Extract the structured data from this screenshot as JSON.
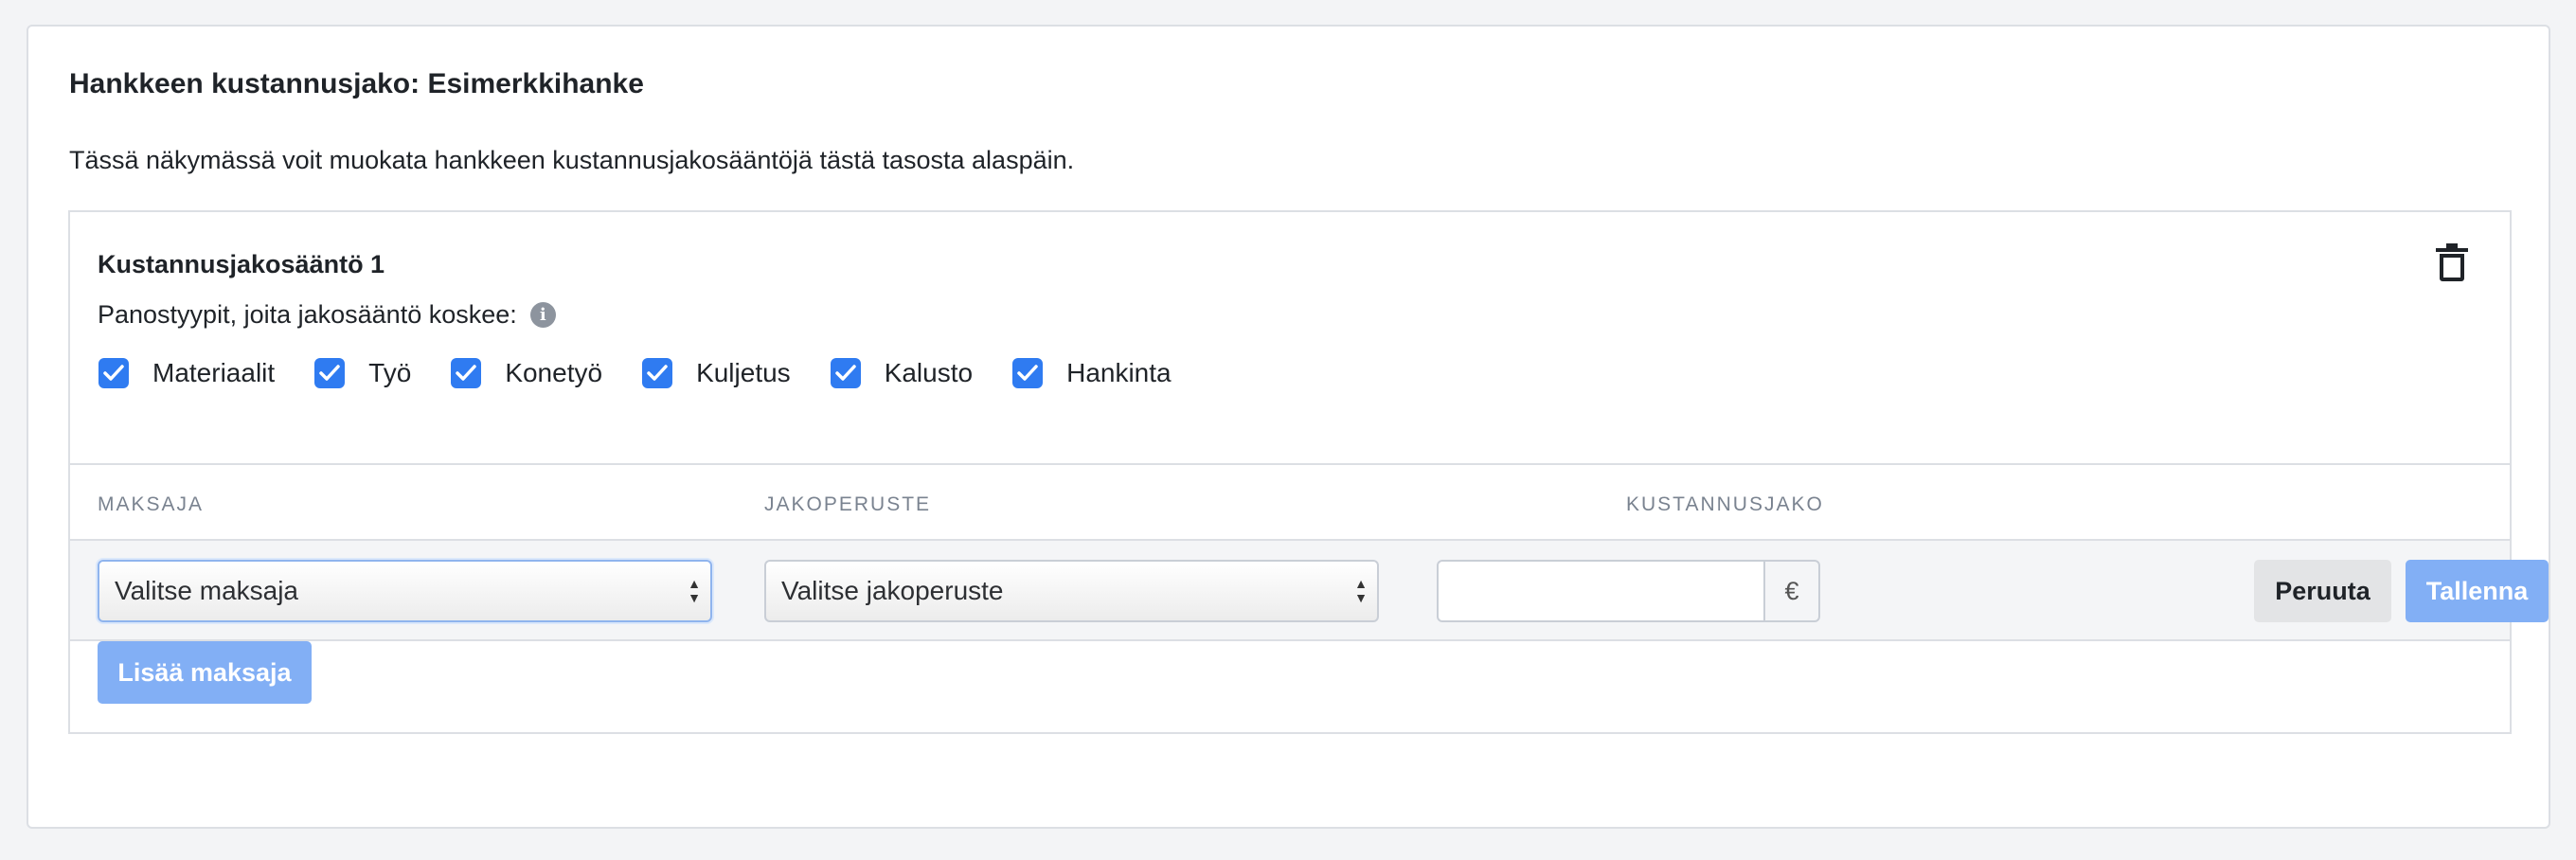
{
  "page": {
    "title": "Hankkeen kustannusjako: Esimerkkihanke",
    "description": "Tässä näkymässä voit muokata hankkeen kustannusjakosääntöjä tästä tasosta alaspäin."
  },
  "rule": {
    "title": "Kustannusjakosääntö 1",
    "types_label": "Panostyypit, joita jakosääntö koskee:",
    "info_glyph": "i",
    "types": [
      {
        "label": "Materiaalit",
        "checked": true
      },
      {
        "label": "Työ",
        "checked": true
      },
      {
        "label": "Konetyö",
        "checked": true
      },
      {
        "label": "Kuljetus",
        "checked": true
      },
      {
        "label": "Kalusto",
        "checked": true
      },
      {
        "label": "Hankinta",
        "checked": true
      }
    ]
  },
  "table": {
    "headers": {
      "payer": "MAKSAJA",
      "basis": "JAKOPERUSTE",
      "split": "KUSTANNUSJAKO"
    },
    "row": {
      "payer_select": "Valitse maksaja",
      "basis_select": "Valitse jakoperuste",
      "amount_value": "",
      "currency": "€",
      "cancel_label": "Peruuta",
      "save_label": "Tallenna"
    }
  },
  "actions": {
    "add_payer_label": "Lisää maksaja"
  },
  "icons": {
    "delete": "trash-icon",
    "info": "info-icon",
    "checkbox": "checkmark-icon"
  },
  "colors": {
    "accent": "#2f7bf1",
    "button_primary_disabled": "#82aff5",
    "button_secondary": "#e3e4e6"
  }
}
